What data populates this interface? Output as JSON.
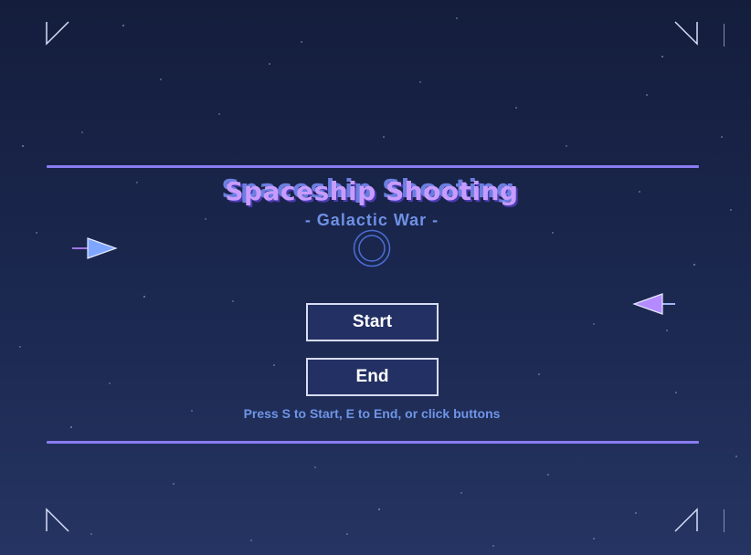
{
  "game": {
    "title": "Spaceship Shooting",
    "subtitle": "- Galactic War -",
    "hint": "Press S to Start, E to End, or click buttons"
  },
  "menu": {
    "start_label": "Start",
    "end_label": "End"
  },
  "icons": {
    "corners": [
      "corner-bracket-icon",
      "corner-bracket-icon",
      "corner-bracket-icon",
      "corner-bracket-icon"
    ],
    "player_ship": "arrow-ship-right-icon",
    "enemy_ship": "arrow-ship-left-icon",
    "emblem": "ring-icon"
  },
  "colors": {
    "background_top": "#141d3c",
    "background_bottom": "#253462",
    "accent_purple": "#8a7cf2",
    "title_fill": "#c89cff",
    "subtitle": "#6f91e6",
    "player_ship": "#7fa6ff",
    "enemy_ship": "#b48bff",
    "button_fill": "#233064",
    "button_border": "#d7dcf3"
  }
}
